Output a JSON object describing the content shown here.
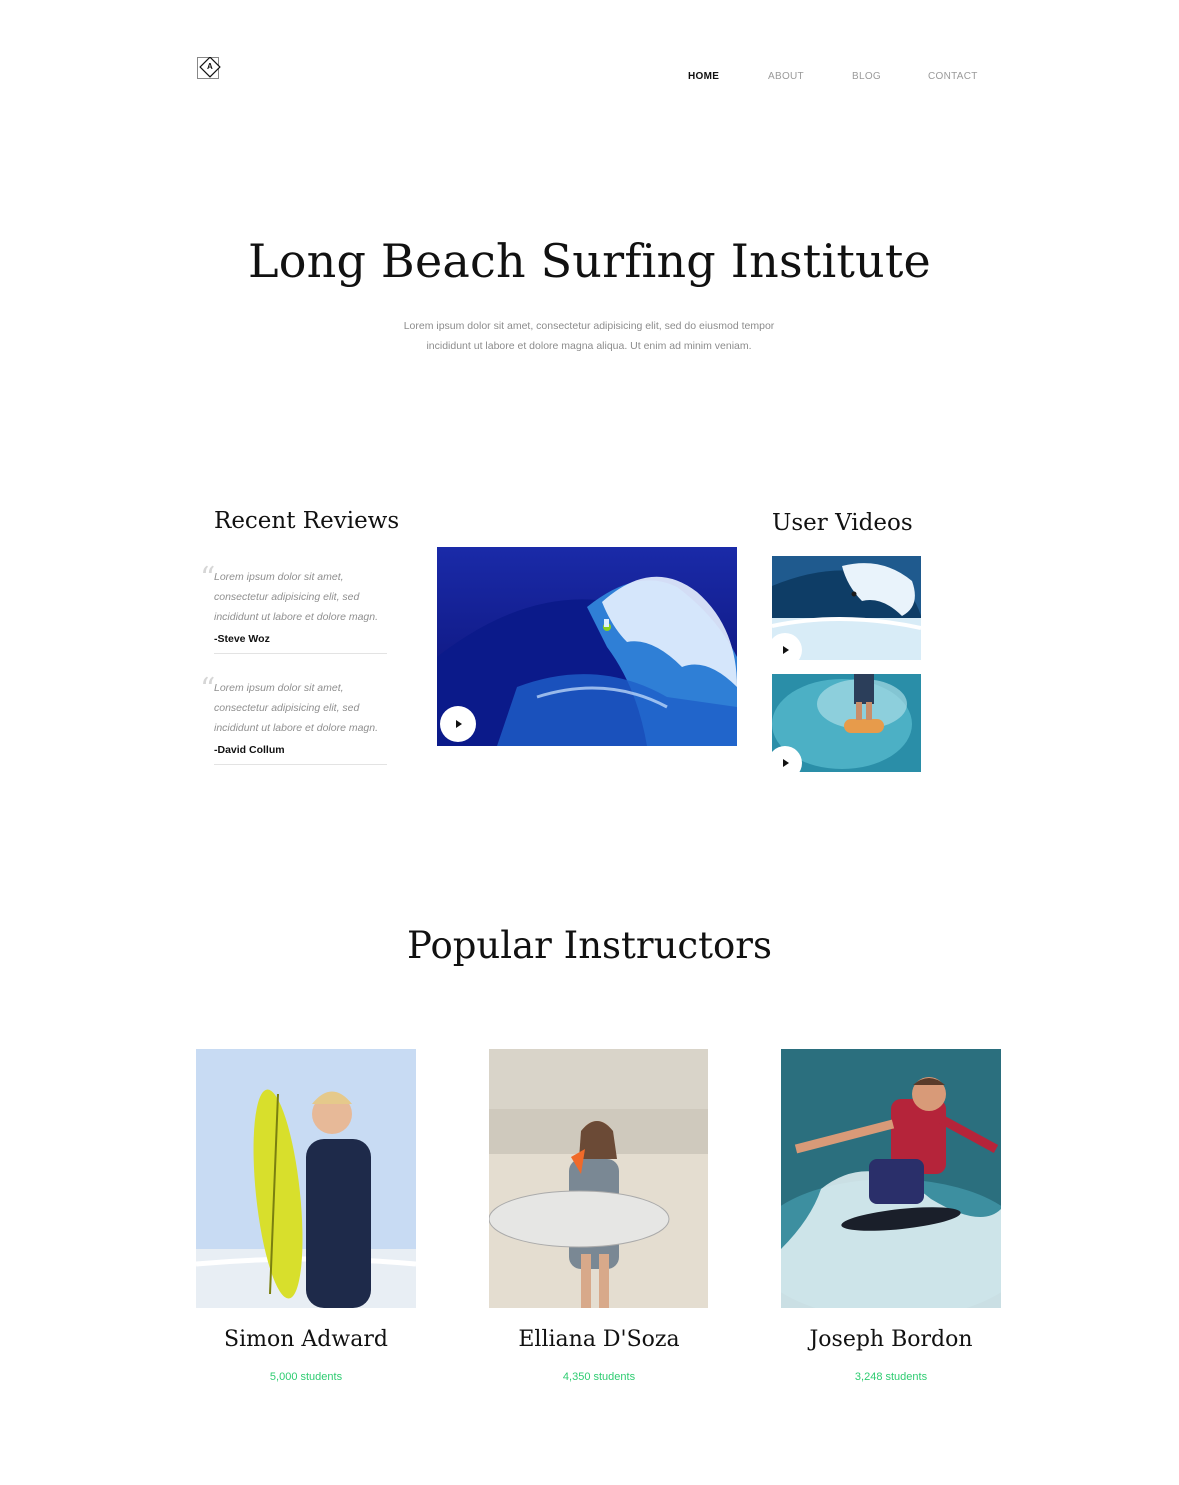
{
  "header": {
    "logo_letter": "A",
    "nav": [
      {
        "label": "HOME",
        "active": true
      },
      {
        "label": "ABOUT",
        "active": false
      },
      {
        "label": "BLOG",
        "active": false
      },
      {
        "label": "CONTACT",
        "active": false
      }
    ]
  },
  "hero": {
    "title": "Long Beach Surfing Institute",
    "subtitle_line1": "Lorem ipsum dolor sit amet, consectetur adipisicing elit, sed do eiusmod tempor",
    "subtitle_line2": "incididunt ut labore et dolore magna aliqua. Ut enim ad minim veniam."
  },
  "reviews": {
    "heading": "Recent Reviews",
    "items": [
      {
        "text": "Lorem ipsum dolor sit amet, consectetur adipisicing elit, sed incididunt ut labore et dolore magn.",
        "author": "-Steve Woz"
      },
      {
        "text": "Lorem ipsum dolor sit amet, consectetur adipisicing elit, sed incididunt ut labore et dolore magn.",
        "author": "-David Collum"
      }
    ]
  },
  "videos": {
    "heading": "User Videos",
    "icons": {
      "play": "play-icon"
    }
  },
  "instructors": {
    "heading": "Popular Instructors",
    "items": [
      {
        "name": "Simon Adward",
        "students": "5,000 students"
      },
      {
        "name": "Elliana D'Soza",
        "students": "4,350 students"
      },
      {
        "name": "Joseph Bordon",
        "students": "3,248 students"
      }
    ]
  },
  "colors": {
    "accent_green": "#2ecc71",
    "text": "#111111",
    "muted": "#8c8c8c"
  }
}
